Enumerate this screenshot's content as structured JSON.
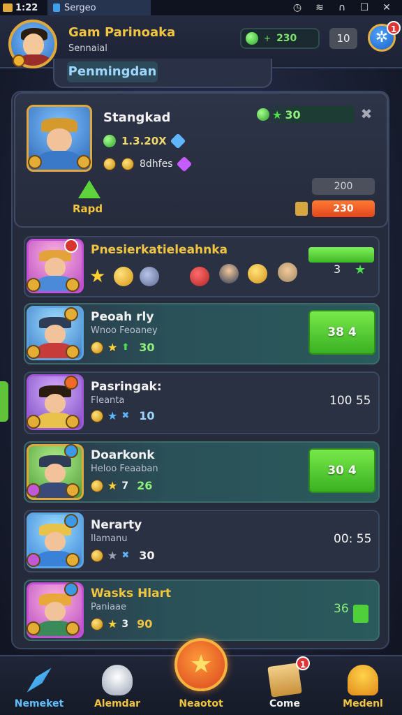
{
  "status_bar": {
    "time": "1:22",
    "app_tab": "Sergeo"
  },
  "header": {
    "player_name": "Gam Parinoaka",
    "player_subtitle": "Sennaial",
    "currency_value": "230",
    "currency_add": "+",
    "level": "10",
    "settings_badge": "1",
    "tab_title": "Penmingdan"
  },
  "featured": {
    "name": "Stangkad",
    "score": "30",
    "stat1": "1.3.20X",
    "stat2": "8dhfes",
    "rapid_label": "Rapd",
    "grey_button": "200",
    "orange_button": "230"
  },
  "rows": [
    {
      "name": "Pnesierkatieleahnka",
      "right": "3"
    },
    {
      "name": "Peoah rly",
      "sub": "Wnoo Feoaney",
      "stat": "30",
      "button": "38 4"
    },
    {
      "name": "Pasringak:",
      "sub": "Fleanta",
      "stat": "10",
      "time": "100 55"
    },
    {
      "name": "Doarkonk",
      "sub": "Heloo Feaaban",
      "stat": "26",
      "button": "30 4"
    },
    {
      "name": "Nerarty",
      "sub": "Ilamanu",
      "stat": "30",
      "time": "00: 55"
    },
    {
      "name": "Wasks Hlart",
      "sub": "Paniaae",
      "stat": "90",
      "right": "36"
    }
  ],
  "bottom_nav": {
    "items": [
      {
        "label": "Nemeket"
      },
      {
        "label": "Alemdar"
      },
      {
        "label": "Neaotot"
      },
      {
        "label": "Come"
      },
      {
        "label": "Medenl"
      }
    ],
    "come_badge": "1"
  },
  "colors": {
    "accent_gold": "#f2c540",
    "accent_green": "#5fd33b",
    "accent_orange": "#e1461d",
    "panel_bg": "#252b3b"
  }
}
